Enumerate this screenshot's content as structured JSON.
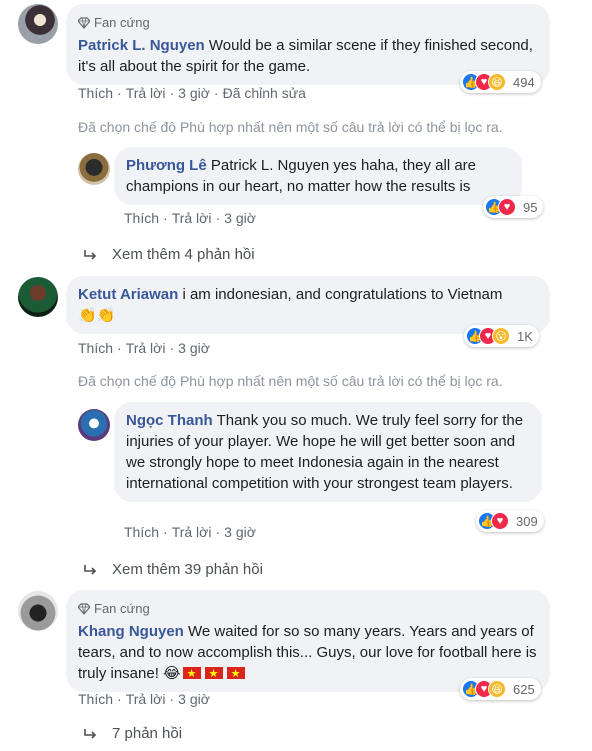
{
  "comments": [
    {
      "badge": "Fan cứng",
      "name": "Patrick L. Nguyen",
      "text": "Would be a similar scene if they finished second, it's all about the spirit for the game.",
      "actions": {
        "like": "Thích",
        "reply": "Trả lời",
        "time": "3 giờ",
        "edited": "Đã chỉnh sửa"
      },
      "reaction_count": "494",
      "reaction_icons": [
        "like-icon",
        "love-icon",
        "haha-icon"
      ]
    },
    {
      "name": "Phương Lê",
      "text": "Patrick L. Nguyen yes haha, they all are champions in our heart, no matter how the results is",
      "actions": {
        "like": "Thích",
        "reply": "Trả lời",
        "time": "3 giờ"
      },
      "reaction_count": "95",
      "reaction_icons": [
        "like-icon",
        "love-icon"
      ]
    },
    {
      "name": "Ketut Ariawan",
      "text": "i am indonesian, and congratulations to Vietnam",
      "emoji": "👏👏",
      "actions": {
        "like": "Thích",
        "reply": "Trả lời",
        "time": "3 giờ"
      },
      "reaction_count": "1K",
      "reaction_icons": [
        "like-icon",
        "love-icon",
        "wow-icon"
      ]
    },
    {
      "name": "Ngọc Thanh",
      "text": "Thank you so much. We truly feel sorry for the injuries of your player. We hope he will get better soon and we strongly hope to meet Indonesia again in the nearest international competition with your strongest team players.",
      "actions": {
        "like": "Thích",
        "reply": "Trả lời",
        "time": "3 giờ"
      },
      "reaction_count": "309",
      "reaction_icons": [
        "like-icon",
        "love-icon"
      ]
    },
    {
      "badge": "Fan cứng",
      "name": "Khang Nguyen",
      "text": "We waited for so so many years. Years and years of tears, and to now accomplish this... Guys, our love for football here is truly insane!",
      "emoji": "😂",
      "actions": {
        "like": "Thích",
        "reply": "Trả lời",
        "time": "3 giờ"
      },
      "reaction_count": "625",
      "reaction_icons": [
        "like-icon",
        "love-icon",
        "haha-icon"
      ]
    }
  ],
  "filter_notice": "Đã chọn chế độ Phù hợp nhất nên một số câu trả lời có thể bị lọc ra.",
  "more_replies": [
    "Xem thêm 4 phản hồi",
    "Xem thêm 39 phản hồi",
    "7 phản hồi"
  ],
  "colors": {
    "name": "#385898",
    "bubble": "#f0f2f5",
    "meta": "#606770",
    "like": "#1877f2",
    "love": "#f0284a",
    "haha": "#f7b928"
  }
}
